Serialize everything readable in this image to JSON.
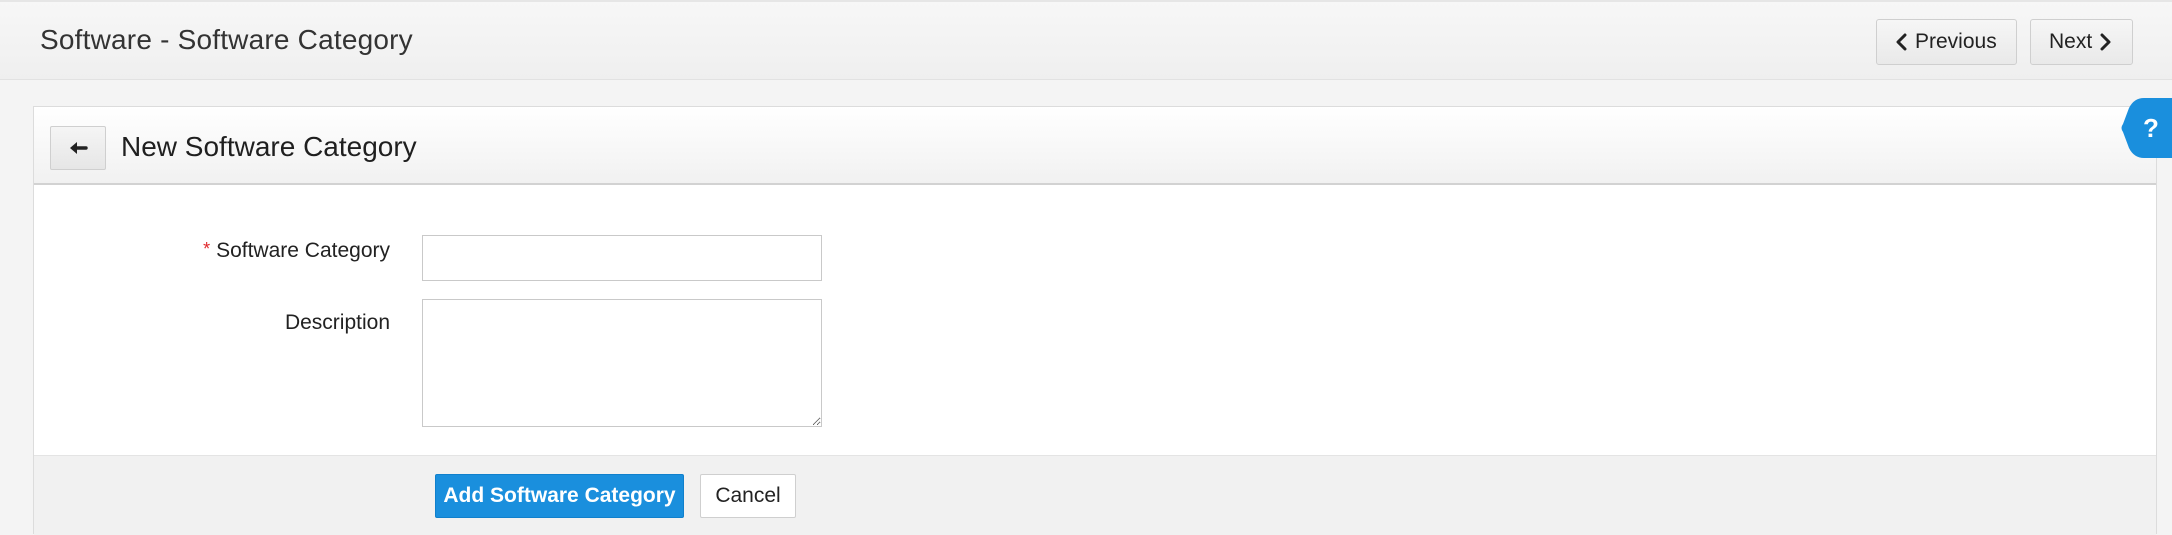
{
  "header": {
    "page_title": "Software - Software Category",
    "previous_label": "Previous",
    "next_label": "Next"
  },
  "card": {
    "title": "New Software Category",
    "back_icon": "arrow-left-icon",
    "help_icon": "question-mark-icon",
    "help_label": "?"
  },
  "form": {
    "required_marker": "*",
    "category_label": "Software Category",
    "category_value": "",
    "description_label": "Description",
    "description_value": ""
  },
  "actions": {
    "submit_label": "Add Software Category",
    "cancel_label": "Cancel"
  },
  "colors": {
    "primary": "#1a8fdd",
    "help_tab": "#1a8fdd",
    "required": "#e0262a"
  }
}
